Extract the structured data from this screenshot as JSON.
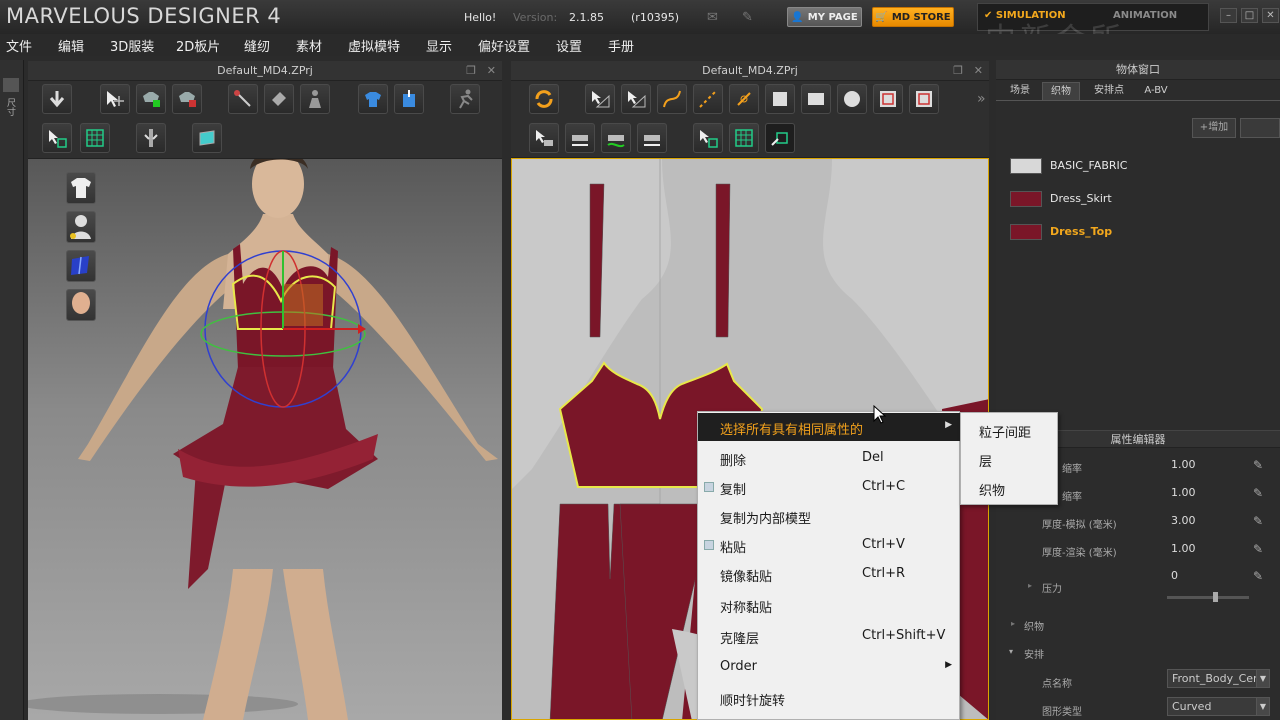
{
  "titlebar": {
    "app_title": "MARVELOUS DESIGNER 4",
    "hello": "Hello!",
    "version_label": "Version:",
    "version": "2.1.85",
    "build": "(r10395)",
    "mypage_label": "MY PAGE",
    "mdstore_label": "MD STORE",
    "simulation_label": "SIMULATION",
    "animation_label": "ANIMATION",
    "watermark": "中新会所"
  },
  "menu": [
    "文件",
    "编辑",
    "3D服装",
    "2D板片",
    "缝纫",
    "素材",
    "虚拟模特",
    "显示",
    "偏好设置",
    "设置",
    "手册"
  ],
  "left_strip_label": "尺寸",
  "panel_3d": {
    "title": "Default_MD4.ZPrj"
  },
  "panel_2d": {
    "title": "Default_MD4.ZPrj"
  },
  "object_browser": {
    "title": "物体窗口",
    "tabs": [
      "场景",
      "织物",
      "安排点",
      "A-BV"
    ],
    "add_label": "增加",
    "fabrics": [
      {
        "name": "BASIC_FABRIC",
        "color": "#d8d8d8",
        "selected": false
      },
      {
        "name": "Dress_Skirt",
        "color": "#7a1628",
        "selected": false
      },
      {
        "name": "Dress_Top",
        "color": "#7a1628",
        "selected": true
      }
    ]
  },
  "property_editor": {
    "title": "属性编辑器",
    "rows": [
      {
        "label": "缩率",
        "value": "1.00"
      },
      {
        "label": "缩率",
        "value": "1.00"
      },
      {
        "label": "厚度-模拟 (毫米)",
        "value": "3.00"
      },
      {
        "label": "厚度-渲染 (毫米)",
        "value": "1.00"
      },
      {
        "label": "压力",
        "value": "0"
      }
    ],
    "section_fabric": "织物",
    "section_arrange": "安排",
    "point_name_label": "点名称",
    "point_name_value": "Front_Body_Cer",
    "shape_type_label": "图形类型",
    "shape_type_value": "Curved"
  },
  "context_menu": {
    "items": [
      {
        "label": "选择所有具有相同属性的",
        "shortcut": "",
        "submenu": true
      },
      {
        "label": "删除",
        "shortcut": "Del",
        "submenu": false
      },
      {
        "label": "复制",
        "shortcut": "Ctrl+C",
        "submenu": false
      },
      {
        "label": "复制为内部模型",
        "shortcut": "",
        "submenu": false
      },
      {
        "label": "粘贴",
        "shortcut": "Ctrl+V",
        "submenu": false
      },
      {
        "label": "镜像黏贴",
        "shortcut": "Ctrl+R",
        "submenu": false
      },
      {
        "label": "对称黏贴",
        "shortcut": "",
        "submenu": false
      },
      {
        "label": "克隆层",
        "shortcut": "Ctrl+Shift+V",
        "submenu": false
      },
      {
        "label": "Order",
        "shortcut": "",
        "submenu": true
      },
      {
        "label": "顺时针旋转",
        "shortcut": "",
        "submenu": false
      }
    ],
    "submenu_items": [
      "粒子间距",
      "层",
      "织物"
    ]
  }
}
